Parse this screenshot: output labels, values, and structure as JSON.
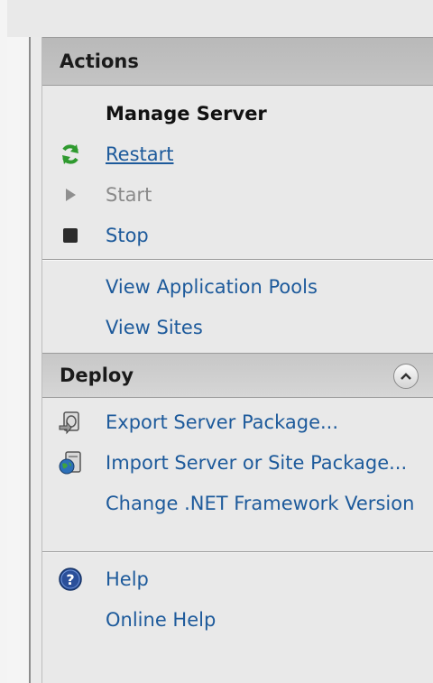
{
  "actions": {
    "title": "Actions",
    "manage_server": {
      "heading": "Manage Server",
      "restart": "Restart",
      "start": "Start",
      "stop": "Stop"
    },
    "links": {
      "view_app_pools": "View Application Pools",
      "view_sites": "View Sites"
    }
  },
  "deploy": {
    "title": "Deploy",
    "export_package": "Export Server Package...",
    "import_package": "Import Server or Site Package...",
    "change_framework": "Change .NET Framework Version"
  },
  "help": {
    "help": "Help",
    "online_help": "Online Help"
  },
  "colors": {
    "link": "#1d5a9b",
    "disabled": "#8a8a8a",
    "header": "#bdbdbd",
    "panel": "#e9e9e9"
  },
  "icons": {
    "restart": "restart-icon",
    "start": "start-icon",
    "stop": "stop-icon",
    "export": "export-package-icon",
    "import": "import-package-icon",
    "help": "help-icon",
    "collapse": "chevron-up-icon"
  }
}
